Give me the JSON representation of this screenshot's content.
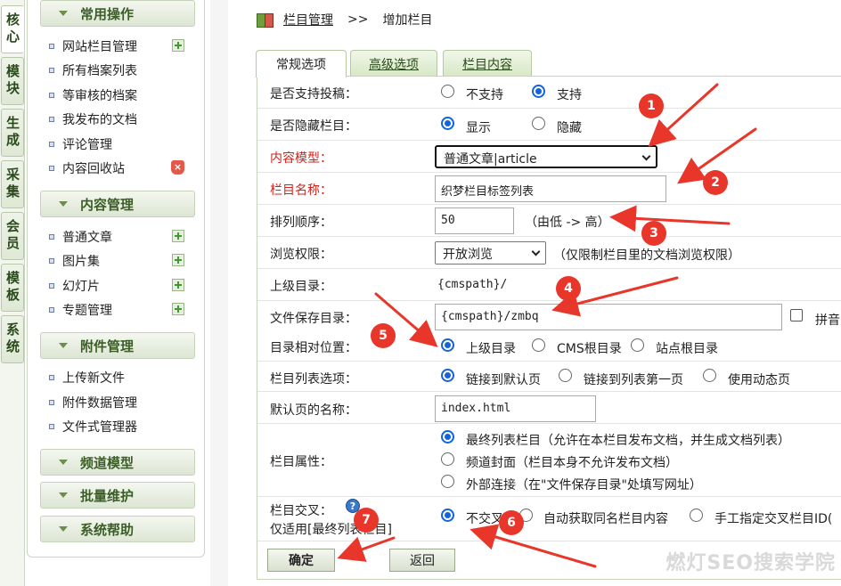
{
  "vertical_tabs": [
    "核心",
    "模块",
    "生成",
    "采集",
    "会员",
    "模板",
    "系统"
  ],
  "menu": {
    "groups": [
      {
        "title": "常用操作",
        "items": [
          {
            "label": "网站栏目管理",
            "icon": "add-icon"
          },
          {
            "label": "所有档案列表",
            "icon": ""
          },
          {
            "label": "等审核的档案",
            "icon": ""
          },
          {
            "label": "我发布的文档",
            "icon": ""
          },
          {
            "label": "评论管理",
            "icon": ""
          },
          {
            "label": "内容回收站",
            "icon": "recycle-bin-icon"
          }
        ]
      },
      {
        "title": "内容管理",
        "items": [
          {
            "label": "普通文章",
            "icon": "add-icon"
          },
          {
            "label": "图片集",
            "icon": "add-icon"
          },
          {
            "label": "幻灯片",
            "icon": "add-icon"
          },
          {
            "label": "专题管理",
            "icon": "add-icon"
          }
        ]
      },
      {
        "title": "附件管理",
        "items": [
          {
            "label": "上传新文件",
            "icon": ""
          },
          {
            "label": "附件数据管理",
            "icon": ""
          },
          {
            "label": "文件式管理器",
            "icon": ""
          }
        ]
      },
      {
        "title": "频道模型",
        "items": []
      },
      {
        "title": "批量维护",
        "items": []
      },
      {
        "title": "系统帮助",
        "items": []
      }
    ]
  },
  "breadcrumb": {
    "link": "栏目管理",
    "sep": ">>",
    "current": "增加栏目"
  },
  "tabs": [
    "常规选项",
    "高级选项",
    "栏目内容"
  ],
  "form": {
    "submission": {
      "label": "是否支持投稿：",
      "options": [
        "不支持",
        "支持"
      ],
      "selected": 1
    },
    "hidden": {
      "label": "是否隐藏栏目：",
      "options": [
        "显示",
        "隐藏"
      ],
      "selected": 0
    },
    "model": {
      "label": "内容模型：",
      "value": "普通文章|article"
    },
    "name": {
      "label": "栏目名称：",
      "value": "织梦栏目标签列表"
    },
    "order": {
      "label": "排列顺序：",
      "value": "50",
      "hint": "（由低 -> 高）"
    },
    "access": {
      "label": "浏览权限：",
      "value": "开放浏览",
      "hint": "（仅限制栏目里的文档浏览权限）"
    },
    "parent": {
      "label": "上级目录：",
      "value": "{cmspath}/"
    },
    "save_dir": {
      "label": "文件保存目录：",
      "value": "{cmspath}/zmbq",
      "pinyin": "拼音"
    },
    "relative": {
      "label": "目录相对位置：",
      "options": [
        "上级目录",
        "CMS根目录",
        "站点根目录"
      ],
      "selected": 0
    },
    "list_option": {
      "label": "栏目列表选项：",
      "options": [
        "链接到默认页",
        "链接到列表第一页",
        "使用动态页"
      ],
      "selected": 0
    },
    "default_page": {
      "label": "默认页的名称：",
      "value": "index.html"
    },
    "attr": {
      "label": "栏目属性：",
      "options": [
        "最终列表栏目（允许在本栏目发布文档，并生成文档列表）",
        "频道封面（栏目本身不允许发布文档）",
        "外部连接（在\"文件保存目录\"处填写网址）"
      ],
      "selected": 0
    },
    "cross": {
      "label": "栏目交叉：",
      "sublabel": "仅适用[最终列表栏目]",
      "options": [
        "不交叉",
        "自动获取同名栏目内容",
        "手工指定交叉栏目ID("
      ],
      "selected": 0
    },
    "confirm": "确定",
    "back": "返回"
  },
  "annotations": [
    "1",
    "2",
    "3",
    "4",
    "5",
    "6",
    "7"
  ],
  "watermark": "燃灯SEO搜索学院",
  "colors": {
    "required_label": "#d2231a",
    "annotation": "#e8362a",
    "radio_selected": "#1464d8",
    "menu_green": "#3a5e26"
  }
}
